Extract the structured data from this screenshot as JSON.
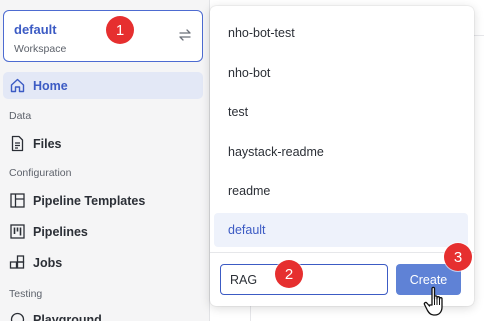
{
  "workspace": {
    "name": "default",
    "label": "Workspace"
  },
  "nav": {
    "home": "Home",
    "section_data": "Data",
    "files": "Files",
    "section_configuration": "Configuration",
    "pipeline_templates": "Pipeline Templates",
    "pipelines": "Pipelines",
    "jobs": "Jobs",
    "section_testing": "Testing",
    "playground": "Playground"
  },
  "dropdown": {
    "workspaces": [
      {
        "name": "nho-bot-test",
        "selected": false
      },
      {
        "name": "nho-bot",
        "selected": false
      },
      {
        "name": "test",
        "selected": false
      },
      {
        "name": "haystack-readme",
        "selected": false
      },
      {
        "name": "readme",
        "selected": false
      },
      {
        "name": "default",
        "selected": true
      }
    ],
    "new_workspace_value": "RAG",
    "create_label": "Create"
  },
  "badges": {
    "one": "1",
    "two": "2",
    "three": "3"
  },
  "colors": {
    "accent": "#3c5bc4",
    "button": "#5f82d6",
    "badge": "#e62f2f",
    "active_bg": "#e3e8f6"
  }
}
